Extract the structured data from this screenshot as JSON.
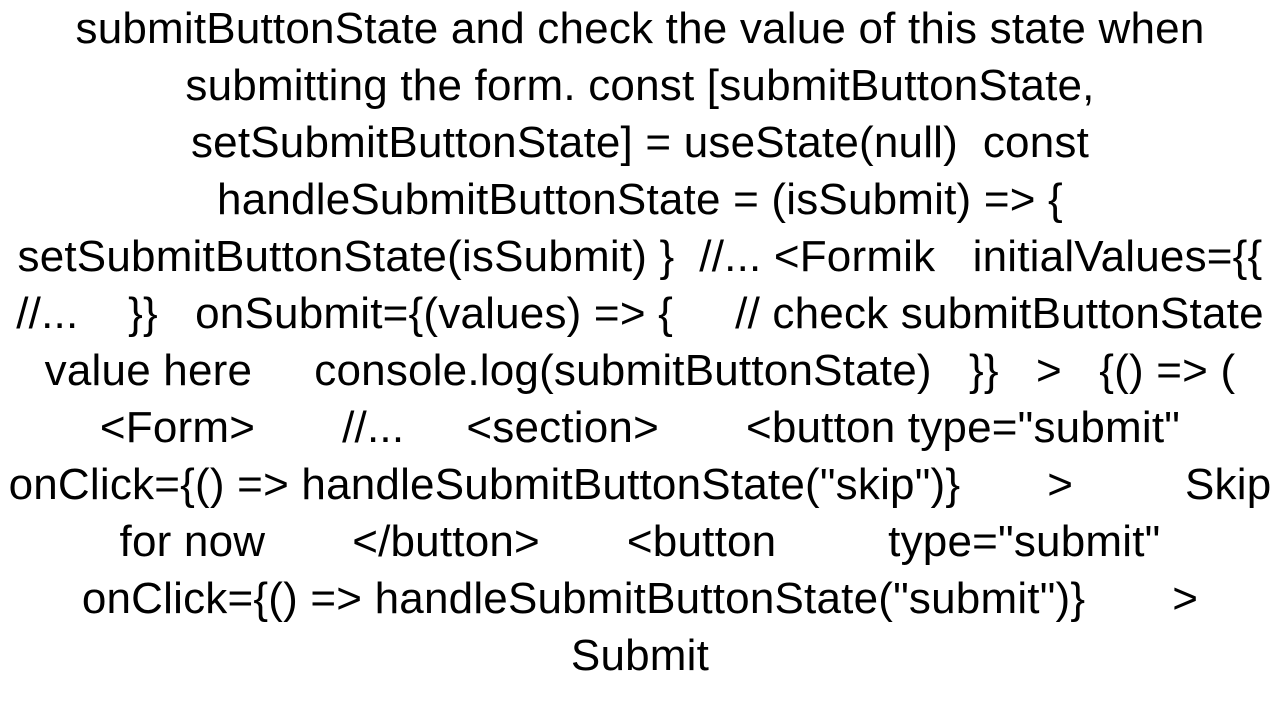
{
  "document": {
    "text": "submitButtonState and check the value of this state when submitting the form. const [submitButtonState, setSubmitButtonState] = useState(null)  const handleSubmitButtonState = (isSubmit) => { setSubmitButtonState(isSubmit) }  //... <Formik   initialValues={{     //...    }}   onSubmit={(values) => {     // check submitButtonState value here     console.log(submitButtonState)   }}   >   {() => (   <Form>       //...     <section>       <button type=\"submit\"         onClick={() => handleSubmitButtonState(\"skip\")}       >         Skip for now       </button>       <button         type=\"submit\"         onClick={() => handleSubmitButtonState(\"submit\")}       >       Submit"
  }
}
